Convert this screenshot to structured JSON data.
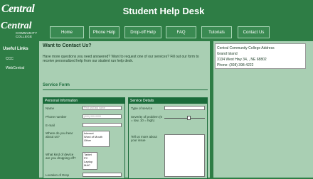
{
  "header": {
    "title": "Student Help Desk",
    "logo": {
      "line1": "Central",
      "line2": "COMMUNITY",
      "line3": "COLLEGE"
    }
  },
  "nav": [
    "Home",
    "Phone Help",
    "Drop-off Help",
    "FAQ",
    "Tutorials",
    "Contact Us"
  ],
  "sidebar": {
    "heading": "Useful Links",
    "links": [
      "CCC",
      "WebCentral"
    ]
  },
  "main": {
    "title": "Want to Contact Us?",
    "intro": "Have more questions you need answered? Want to request one of our services? Fill out our form to receive personalized help from our student run help desk.",
    "section": "Service Form",
    "personal": {
      "heading": "Personal Information",
      "name_label": "Name",
      "name_placeholder": "First and last name",
      "phone_label": "Phone number",
      "phone_placeholder": "(000) 000-0000",
      "email_label": "E-mail",
      "heard_label": "Where do you hear about us?",
      "heard_options": [
        "Internet",
        "Word of Mouth",
        "Other"
      ],
      "device_label": "What kind of device are you dropping off?",
      "device_options": [
        "Tablet",
        "PC",
        "Laptop",
        "MAC"
      ],
      "dropoff_label": "Location of Drop"
    },
    "service": {
      "heading": "Service Details",
      "type_label": "Type of service",
      "severity_label": "Severity of problem (0 = low, 10 = high)",
      "severity_value": 6,
      "issue_label": "Tell us more about your issue"
    }
  },
  "right": {
    "lines": [
      "Central Community College Address",
      "Grand Island",
      "3134 West Hwy 34, , NE 68802",
      "Phone: (308) 398-4222"
    ]
  }
}
